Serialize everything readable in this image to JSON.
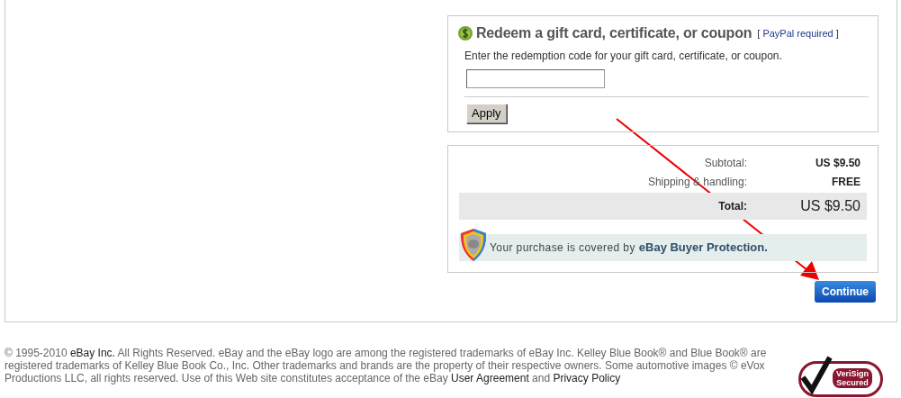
{
  "redeem": {
    "title": "Redeem a gift card, certificate, or coupon",
    "note_open": "[",
    "note_link": "PayPal required",
    "note_close": "]",
    "instructions": "Enter the redemption code for your gift card, certificate, or coupon.",
    "code_field": {
      "kind": "text"
    },
    "apply_button": "Apply"
  },
  "summary": {
    "rows": [
      {
        "label": "Subtotal:",
        "value": "US $9.50",
        "kind": "line"
      },
      {
        "label": "Shipping & handling:",
        "value": "FREE",
        "kind": "line"
      },
      {
        "label": "Total:",
        "value": "US $9.50",
        "kind": "total"
      }
    ],
    "protection": {
      "text": "Your purchase is covered by",
      "brand": "eBay Buyer Protection."
    }
  },
  "continue_button": "Continue",
  "annotation": {
    "kind": "arrow"
  },
  "footer": {
    "segments": [
      {
        "text": "© 1995-2010 ",
        "kind": "text"
      },
      {
        "text": "eBay Inc.",
        "kind": "link"
      },
      {
        "text": " All Rights Reserved. eBay and the eBay logo are among the registered trademarks of eBay Inc. Kelley Blue Book® and Blue Book® are registered trademarks of Kelley Blue Book Co., Inc. Other trademarks and brands are the property of their respective owners. Some automotive images © eVox Productions LLC, all rights reserved. Use of this Web site constitutes acceptance of the eBay ",
        "kind": "text"
      },
      {
        "text": "User Agreement",
        "kind": "link"
      },
      {
        "text": " and ",
        "kind": "text"
      },
      {
        "text": "Privacy Policy",
        "kind": "link"
      }
    ],
    "seal": {
      "line_1": "VeriSign",
      "line_2": "Secured"
    }
  }
}
